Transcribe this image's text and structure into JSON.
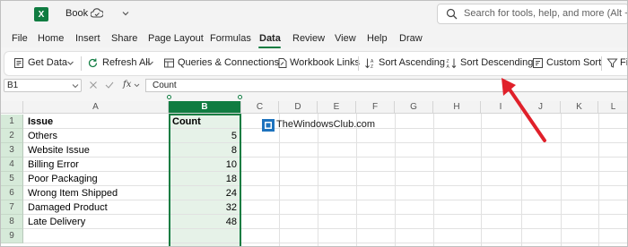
{
  "titlebar": {
    "app_logo": "X",
    "book_title": "Book",
    "search_placeholder": "Search for tools, help, and more (Alt + Q)",
    "icons": [
      "excel-logo",
      "autosave-icon",
      "chevron-down-icon",
      "search-icon"
    ]
  },
  "menu": {
    "tabs": [
      "File",
      "Home",
      "Insert",
      "Share",
      "Page Layout",
      "Formulas",
      "Data",
      "Review",
      "View",
      "Help",
      "Draw"
    ],
    "active": "Data"
  },
  "ribbon": {
    "get_data": "Get Data",
    "refresh_all": "Refresh All",
    "queries": "Queries & Connections",
    "workbook_links": "Workbook Links",
    "sort_asc": "Sort Ascending",
    "sort_desc": "Sort Descending",
    "custom_sort": "Custom Sort",
    "filter_partial": "Fi"
  },
  "formula_bar": {
    "name_box": "B1",
    "fx": "fx",
    "formula": "Count"
  },
  "grid": {
    "columns": [
      "A",
      "B",
      "C",
      "D",
      "E",
      "F",
      "G",
      "H",
      "I",
      "J",
      "K",
      "L"
    ],
    "selected_column": "B",
    "rows": [
      "1",
      "2",
      "3",
      "4",
      "5",
      "6",
      "7",
      "8",
      "9"
    ],
    "data": [
      {
        "a": "Issue",
        "b": "Count"
      },
      {
        "a": "Others",
        "b": "5"
      },
      {
        "a": "Website Issue",
        "b": "8"
      },
      {
        "a": "Billing Error",
        "b": "10"
      },
      {
        "a": "Poor Packaging",
        "b": "18"
      },
      {
        "a": "Wrong Item Shipped",
        "b": "24"
      },
      {
        "a": "Damaged Product",
        "b": "32"
      },
      {
        "a": "Late Delivery",
        "b": "48"
      }
    ]
  },
  "watermark": "TheWindowsClub.com",
  "colors": {
    "accent": "#107c41",
    "arrow": "#e0202a"
  }
}
